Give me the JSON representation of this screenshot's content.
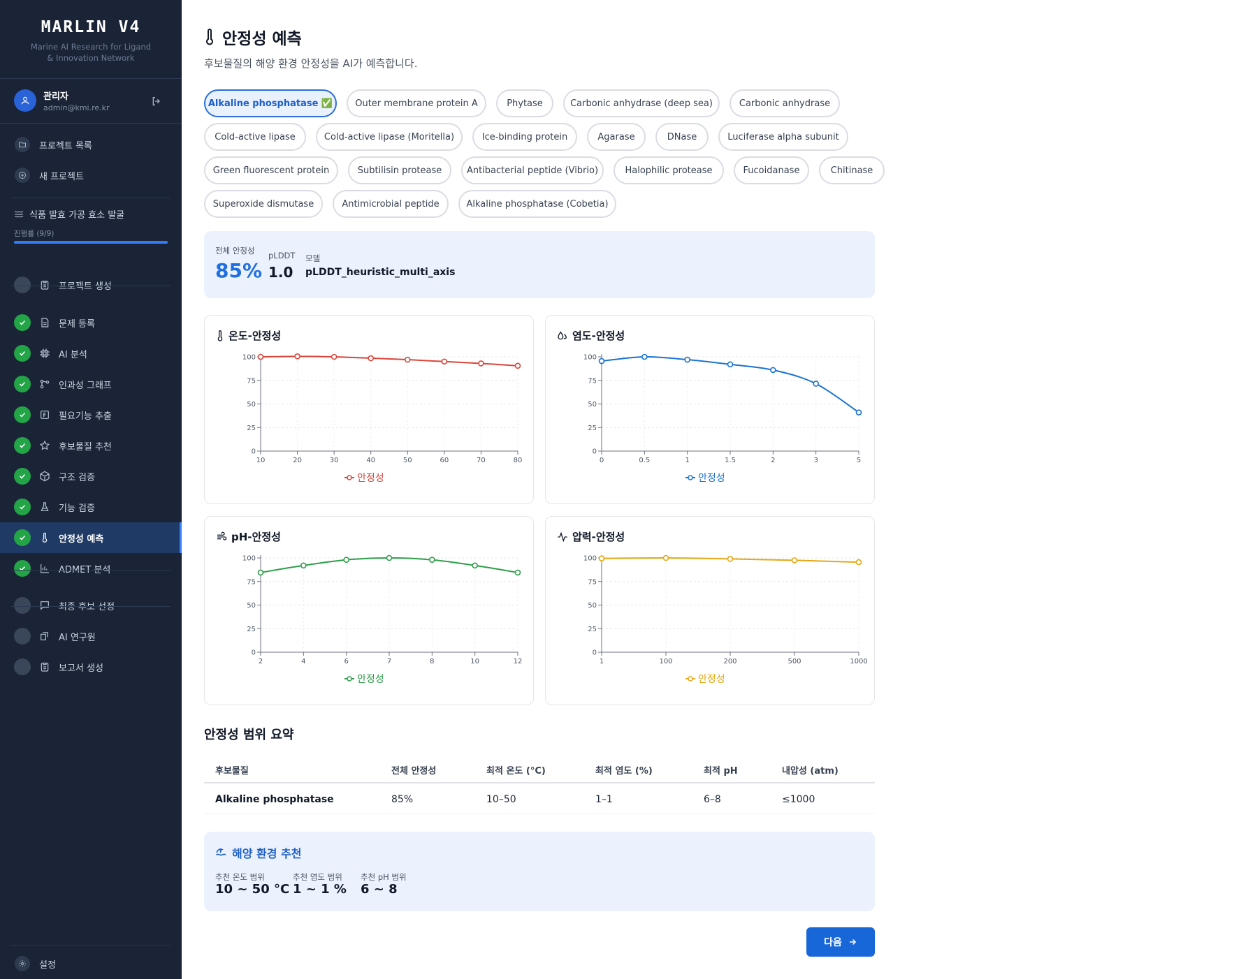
{
  "brand": {
    "title": "MARLIN V4",
    "subtitle": "Marine AI Research for Ligand & Innovation Network"
  },
  "user": {
    "name": "관리자",
    "email": "admin@kmi.re.kr"
  },
  "nav": {
    "projects": "프로젝트 목록",
    "new_project": "새 프로젝트"
  },
  "project": {
    "name": "식품 발효 가공 효소 발굴",
    "progress_label": "진행률 (9/9)",
    "progress_fraction": 1.0
  },
  "steps": [
    {
      "label": "프로젝트 생성",
      "status": "todo",
      "icon": "clipboard-icon"
    },
    {
      "label": "문제 등록",
      "status": "done",
      "icon": "document-icon"
    },
    {
      "label": "AI 분석",
      "status": "done",
      "icon": "cpu-icon"
    },
    {
      "label": "인과성 그래프",
      "status": "done",
      "icon": "graph-icon"
    },
    {
      "label": "필요기능 추출",
      "status": "done",
      "icon": "function-icon"
    },
    {
      "label": "후보물질 추천",
      "status": "done",
      "icon": "star-icon"
    },
    {
      "label": "구조 검증",
      "status": "done",
      "icon": "cube-icon"
    },
    {
      "label": "기능 검증",
      "status": "done",
      "icon": "flask-icon"
    },
    {
      "label": "안정성 예측",
      "status": "done",
      "icon": "thermometer-icon",
      "active": true
    },
    {
      "label": "ADMET 분석",
      "status": "done",
      "icon": "bar-chart-icon"
    },
    {
      "label": "최종 후보 선정",
      "status": "todo",
      "icon": "message-icon"
    },
    {
      "label": "AI 연구원",
      "status": "todo",
      "icon": "share-icon"
    },
    {
      "label": "보고서 생성",
      "status": "todo",
      "icon": "clipboard-icon"
    }
  ],
  "settings_label": "설정",
  "page": {
    "title": "안정성 예측",
    "subtitle": "후보물질의 해양 환경 안정성을 AI가 예측합니다."
  },
  "candidates": [
    "Alkaline phosphatase ✅",
    "Outer membrane protein A",
    "Phytase",
    "Carbonic anhydrase (deep sea)",
    "Carbonic anhydrase",
    "Cold-active lipase",
    "Cold-active lipase (Moritella)",
    "Ice-binding protein",
    "Agarase",
    "DNase",
    "Luciferase alpha subunit",
    "Green fluorescent protein",
    "Subtilisin protease",
    "Antibacterial peptide (Vibrio)",
    "Halophilic protease",
    "Fucoidanase",
    "Chitinase",
    "Superoxide dismutase",
    "Antimicrobial peptide",
    "Alkaline phosphatase (Cobetia)"
  ],
  "summary": {
    "overall_label": "전체 안정성",
    "overall_value": "85%",
    "plddt_label": "pLDDT",
    "plddt_value": "1.0",
    "model_label": "모델",
    "model_value": "pLDDT_heuristic_multi_axis"
  },
  "chart_data": [
    {
      "type": "line",
      "title": "온도-안정성",
      "categories": [
        "10",
        "20",
        "30",
        "40",
        "50",
        "60",
        "70",
        "80"
      ],
      "series": [
        {
          "name": "안정성",
          "values": [
            100,
            100.5,
            100,
            98.5,
            97,
            95,
            93,
            90.5
          ]
        }
      ],
      "yticks": [
        "0",
        "25",
        "50",
        "75",
        "100"
      ],
      "ylim": [
        0,
        100
      ],
      "color": "#d9463b",
      "grid": true,
      "legend": "bottom"
    },
    {
      "type": "line",
      "title": "염도-안정성",
      "categories": [
        "0",
        "0.5",
        "1",
        "1.5",
        "2",
        "3",
        "5"
      ],
      "series": [
        {
          "name": "안정성",
          "values": [
            95.5,
            100,
            97,
            92,
            86,
            71.5,
            41
          ]
        }
      ],
      "yticks": [
        "0",
        "25",
        "50",
        "75",
        "100"
      ],
      "ylim": [
        0,
        100
      ],
      "color": "#1a73d1",
      "grid": true,
      "legend": "bottom"
    },
    {
      "type": "line",
      "title": "pH-안정성",
      "categories": [
        "2",
        "4",
        "6",
        "7",
        "8",
        "10",
        "12"
      ],
      "series": [
        {
          "name": "안정성",
          "values": [
            84.5,
            92,
            98,
            100,
            98,
            92,
            84.5
          ]
        }
      ],
      "yticks": [
        "0",
        "25",
        "50",
        "75",
        "100"
      ],
      "ylim": [
        0,
        100
      ],
      "color": "#2e9e4a",
      "grid": true,
      "legend": "bottom"
    },
    {
      "type": "line",
      "title": "압력-안정성",
      "categories": [
        "1",
        "100",
        "200",
        "500",
        "1000"
      ],
      "series": [
        {
          "name": "안정성",
          "values": [
            99.5,
            100,
            99,
            97.5,
            95.5
          ]
        }
      ],
      "yticks": [
        "0",
        "25",
        "50",
        "75",
        "100"
      ],
      "ylim": [
        0,
        100
      ],
      "color": "#e5a712",
      "grid": true,
      "legend": "bottom"
    }
  ],
  "range": {
    "title": "안정성 범위 요약",
    "headers": [
      "후보물질",
      "전체 안정성",
      "최적 온도 (°C)",
      "최적 염도 (%)",
      "최적 pH",
      "내압성 (atm)"
    ],
    "row": [
      "Alkaline phosphatase",
      "85%",
      "10–50",
      "1–1",
      "6–8",
      "≤1000"
    ]
  },
  "recommend": {
    "title": "해양 환경 추천",
    "temp_label": "추천 온도 범위",
    "temp_value": "10 ~ 50 °C",
    "salt_label": "추천 염도 범위",
    "salt_value": "1 ~ 1 %",
    "ph_label": "추천 pH 범위",
    "ph_value": "6 ~ 8"
  },
  "next_label": "다음"
}
